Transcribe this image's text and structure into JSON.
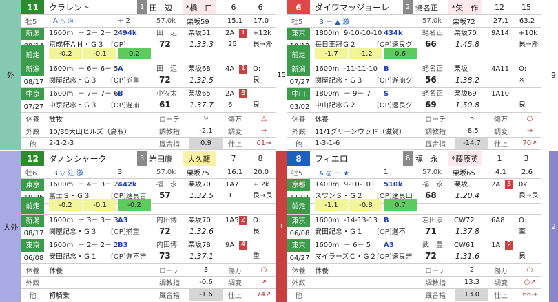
{
  "outer": {
    "left_top": "外",
    "left_bottom": "大外",
    "right_top": "9",
    "right_bottom": "2",
    "center_top": "15",
    "center_bottom": "1"
  },
  "horses": [
    {
      "num": "11",
      "num_bg": "#2e8b2e",
      "name": "クラレント",
      "post": "1",
      "jockey_prev": "田　辺",
      "jockey_now": "*橋　口",
      "now_bg": "#fde9ec",
      "pop": "6",
      "odds": "6",
      "age": "牡5",
      "marks": "A △ ◎",
      "plus": "+ 2",
      "wt": "57.0k",
      "trainer": "栗坂59",
      "n1": "15.1",
      "n2": "17.0",
      "races": [
        {
          "code": "新潟",
          "date": "09/14",
          "code_bg": "#3c9c4c",
          "l1a": "1600m",
          "l1b": "－ 2－ 2－ 2",
          "l1c": "494k",
          "l2a": "京成杯ＡＨ・Ｇ３",
          "l2b": "[OP]",
          "j": "田　辺",
          "jw": "72",
          "tr": "栗坂51",
          "tm": "1.33.3",
          "g1": "2A",
          "g1n": "1",
          "g2": "25",
          "st": "+12k",
          "st2": "良→外"
        },
        {
          "code": "新潟",
          "date": "08/17",
          "code_bg": "#3c9c4c",
          "l1a": "1600m",
          "l1b": "－ 6－ 6－ 5",
          "l1c": "A",
          "l2a": "関屋記念・Ｇ３",
          "l2b": "[OP]揃重",
          "j": "田　辺",
          "jw": "72",
          "tr": "栗坂68",
          "tm": "1.32.5",
          "g1": "4A",
          "g1n": "1",
          "g2": "",
          "st": "O:",
          "st2": "良"
        },
        {
          "code": "中京",
          "date": "07/27",
          "code_bg": "#3c9c4c",
          "l1a": "1600m",
          "l1b": "－ 7－ 7－ 6",
          "l1c": "B",
          "l2a": "中京記念・Ｇ３",
          "l2b": "[OP]遅揃",
          "j": "小牧太",
          "jw": "61",
          "tr": "栗坂65",
          "tm": "1.37.7",
          "g1": "2A",
          "g1n": "8",
          "g2": "6",
          "st": "",
          "st2": "良"
        }
      ],
      "prev": {
        "a": "-0.2",
        "b": "-0.1",
        "c": "0.2"
      },
      "rest": "放牧",
      "out": "10/30大山ヒルズ（鳥取）",
      "other": "2-1-2-3",
      "lt": {
        "r1": "ローテ",
        "r2": "調教指",
        "r3": "厩舎指",
        "v1": "9",
        "v2": "-2.1",
        "v3": "0.9",
        "h1": "傷万",
        "h2": "調変",
        "h3": "仕上",
        "m1": "△",
        "m2": "→",
        "m3": "61→"
      }
    },
    {
      "num": "6",
      "num_bg": "#e04848",
      "name": "ダイワマッジョーレ",
      "post": "2",
      "jockey_prev": "蛯名正",
      "jockey_now": "*矢　作",
      "now_bg": "#fde9ec",
      "pop": "12",
      "odds": "15",
      "age": "牡5",
      "marks": "B －  ▲  激",
      "plus": "",
      "wt": "57.0k",
      "trainer": "栗坂72",
      "n1": "27.1",
      "n2": "63.2",
      "races": [
        {
          "code": "東京",
          "date": "10/12",
          "code_bg": "#3c9c4c",
          "l1a": "1800m",
          "l1b": "9-10-10-10",
          "l1c": "434k",
          "l2a": "毎日王冠Ｇ２",
          "l2b": "[OP]速良グ",
          "j": "蛯名正",
          "jw": "66",
          "tr": "栗坂70",
          "tm": "1.45.8",
          "g1": "9A14",
          "g1n": "",
          "g2": "",
          "st": "+10k",
          "st2": "良→外"
        },
        {
          "code": "新潟",
          "date": "07/27",
          "code_bg": "#3c9c4c",
          "l1a": "1600m",
          "l1b": "-11-11-10",
          "l1c": "B",
          "l2a": "関屋記念・Ｇ３",
          "l2b": "[OP]遅揃グ",
          "j": "蛯名正",
          "jw": "56",
          "tr": "栗坂",
          "tm": "1.38.2",
          "g1": "4A11",
          "g1n": "",
          "g2": "",
          "st": "O:",
          "st2": "×"
        },
        {
          "code": "中山",
          "date": "03/02",
          "code_bg": "#3c9c4c",
          "l1a": "1800m",
          "l1b": "－ 9－ 7",
          "l1c": "S",
          "l2a": "中山記念Ｇ２",
          "l2b": "[OP]速良グ",
          "j": "蛯名正",
          "jw": "69",
          "tr": "栗坂69",
          "tm": "1.50.8",
          "g1": "1A10",
          "g1n": "",
          "g2": "",
          "st": "",
          "st2": "良"
        }
      ],
      "prev": {
        "a": "-1.7",
        "b": "-1.2",
        "c": "0.6"
      },
      "rest": "休養",
      "out": "11/1グリーンウッド（滋賀）",
      "other": "1-3-1-6",
      "lt": {
        "r1": "ローテ",
        "r2": "調教指",
        "r3": "厩舎指",
        "v1": "5",
        "v2": "-8.5",
        "v3": "-14.7",
        "h1": "傷万",
        "h2": "調変",
        "h3": "仕上",
        "m1": "○",
        "m2": "→",
        "m3": "70↗"
      }
    },
    {
      "num": "12",
      "num_bg": "#2e8b2e",
      "name": "ダノンシャーク",
      "post": "3",
      "jockey_prev": "岩田康",
      "jockey_now": "大久龍",
      "now_bg": "#fff2a8",
      "pop": "7",
      "odds": "8",
      "age": "牡6",
      "marks": "B ▽ 注  激",
      "plus": "3",
      "wt": "57.0k",
      "trainer": "栗坂75",
      "n1": "16.1",
      "n2": "20.0",
      "races": [
        {
          "code": "東京",
          "date": "10/25",
          "code_bg": "#3c9c4c",
          "l1a": "1600m",
          "l1b": "－ 4－ 3－ 2",
          "l1c": "442k",
          "l2a": "富士Ｓ・Ｇ３",
          "l2b": "[OP]速良吉",
          "j": "福　永",
          "jw": "57",
          "tr": "栗坂70",
          "tm": "1.32.5",
          "g1": "1A7",
          "g1n": "",
          "g2": "1",
          "st": "+ 2k",
          "st2": "良→良"
        },
        {
          "code": "新潟",
          "date": "08/17",
          "code_bg": "#3c9c4c",
          "l1a": "1600m",
          "l1b": "－ 3－ 3－ 3",
          "l1c": "A3",
          "l2a": "関屋記念・Ｇ３",
          "l2b": "[OP]揃重",
          "j": "内田博",
          "jw": "72",
          "tr": "栗坂70",
          "tm": "1.32.6",
          "g1": "1A5",
          "g1n": "2",
          "g2": "",
          "st": "O:",
          "st2": "良"
        },
        {
          "code": "東京",
          "date": "06/08",
          "code_bg": "#3c9c4c",
          "l1a": "1600m",
          "l1b": "－ 2－ 2－ 2",
          "l1c": "B3",
          "l2a": "安田記念・Ｇ１",
          "l2b": "[OP]遅不吉",
          "j": "内田博",
          "jw": "73",
          "tr": "栗坂78",
          "tm": "1.37.1",
          "g1": "9A",
          "g1n": "4",
          "g2": "",
          "st": "",
          "st2": "重"
        }
      ],
      "prev": {
        "a": "-0.2",
        "b": "-0.1",
        "c": "-0.2"
      },
      "rest": "休養",
      "out": "",
      "other": "初騎乗",
      "lt": {
        "r1": "ローテ",
        "r2": "調教指",
        "r3": "厩舎指",
        "v1": "3",
        "v2": "-0.6",
        "v3": "-1.6",
        "h1": "傷万",
        "h2": "調変",
        "h3": "仕上",
        "m1": "○",
        "m2": "↗",
        "m3": "74↗"
      }
    },
    {
      "num": "8",
      "num_bg": "#1f5fbf",
      "name": "フィエロ",
      "post": "6",
      "jockey_prev": "福　永",
      "jockey_now": "*藤原英",
      "now_bg": "#fde9ec",
      "pop": "1",
      "odds": "3",
      "age": "牡5",
      "marks": "A ◎ －  ★",
      "plus": "1",
      "wt": "57.0k",
      "trainer": "栗坂65",
      "n1": "4.1",
      "n2": "2.6",
      "races": [
        {
          "code": "京都",
          "date": "11/01",
          "code_bg": "#3c9c4c",
          "l1a": "1400m",
          "l1b": "9-10-10",
          "l1c": "510k",
          "l2a": "スワンＳ・Ｇ２",
          "l2b": "[OP]速良山",
          "j": "福　永",
          "jw": "68",
          "tr": "栗坂",
          "tm": "1.20.4",
          "g1": "2A",
          "g1n": "3",
          "g2": "",
          "st": "0k",
          "st2": "良→良"
        },
        {
          "code": "東京",
          "date": "06/08",
          "code_bg": "#3c9c4c",
          "l1a": "1600m",
          "l1b": "-14-13-13",
          "l1c": "B",
          "l2a": "安田記念・Ｇ１",
          "l2b": "[OP]遅不",
          "j": "岩田康",
          "jw": "71",
          "tr": "CW72",
          "tm": "1.37.8",
          "g1": "6A8",
          "g1n": "",
          "g2": "",
          "st": "O:",
          "st2": "重"
        },
        {
          "code": "東京",
          "date": "04/27",
          "code_bg": "#3c9c4c",
          "l1a": "1600m",
          "l1b": "－ 6－ 5",
          "l1c": "A3",
          "l2a": "マイラーズＣ・Ｇ２",
          "l2b": "[OP]速良吉",
          "j": "武　豊",
          "jw": "72",
          "tr": "CW61",
          "tm": "1.31.6",
          "g1": "1A",
          "g1n": "2",
          "g2": "",
          "st": "",
          "st2": "良"
        }
      ],
      "prev": {
        "a": "-1.1",
        "b": "-0.8",
        "c": "0.7"
      },
      "rest": "休養",
      "out": "",
      "other": "",
      "lt": {
        "r1": "ローテ",
        "r2": "調教指",
        "r3": "厩舎指",
        "v1": "2",
        "v2": "13.3",
        "v3": "13.0",
        "h1": "傷万",
        "h2": "調変",
        "h3": "仕上",
        "m1": "○",
        "m2": "○↗",
        "m3": "66→"
      }
    }
  ]
}
